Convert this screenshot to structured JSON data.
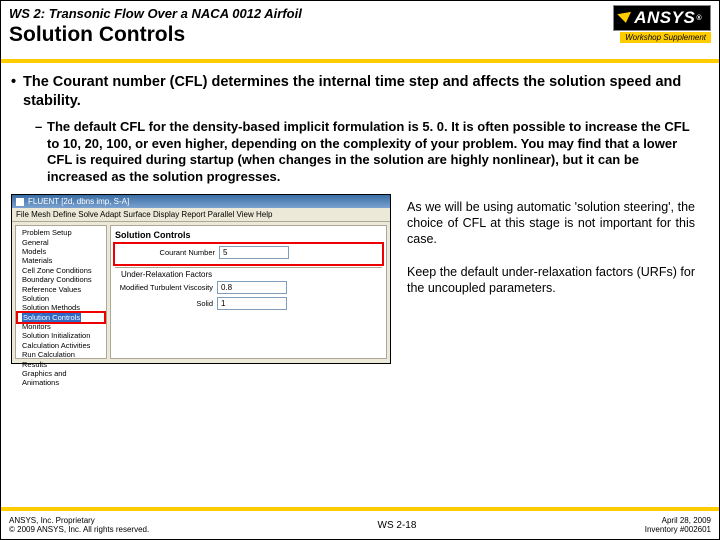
{
  "header": {
    "supertitle": "WS 2: Transonic Flow Over a NACA 0012 Airfoil",
    "title": "Solution Controls",
    "brand": "ANSYS",
    "supplement": "Workshop Supplement"
  },
  "bullets": {
    "main": "The Courant number (CFL) determines the internal time step and affects the solution speed and stability.",
    "sub": "The default CFL for the density-based implicit formulation is 5. 0. It is often possible to increase the CFL to 10, 20, 100, or even higher, depending on the complexity of your problem. You may find that a lower CFL is required during startup (when changes in the solution are highly nonlinear), but it can be increased as the solution progresses."
  },
  "shot": {
    "title": "FLUENT [2d, dbns imp, S-A]",
    "menu": "File  Mesh  Define  Solve  Adapt  Surface  Display  Report  Parallel  View  Help",
    "tree": [
      "Problem Setup",
      "General",
      "Models",
      "Materials",
      "Cell Zone Conditions",
      "Boundary Conditions",
      "Reference Values",
      "Solution",
      "Solution Methods",
      "",
      "Solution Controls",
      "Monitors",
      "Solution Initialization",
      "Calculation Activities",
      "Run Calculation",
      "Results",
      "Graphics and Animations"
    ],
    "panel": {
      "title": "Solution Controls",
      "courant_label": "Courant Number",
      "courant_value": "5",
      "urf_header": "Under-Relaxation Factors",
      "tv_label": "Modified Turbulent Viscosity",
      "tv_value": "0.8",
      "solid_label": "Solid",
      "solid_value": "1"
    }
  },
  "aside": {
    "p1": "As we will be using automatic 'solution steering', the choice of CFL at this stage is not important for this case.",
    "p2": "Keep the default under-relaxation factors (URFs) for the uncoupled parameters."
  },
  "footer": {
    "left1": "ANSYS, Inc. Proprietary",
    "left2": "© 2009 ANSYS, Inc. All rights reserved.",
    "page": "WS 2-18",
    "right1": "April 28, 2009",
    "right2": "Inventory #002601"
  }
}
